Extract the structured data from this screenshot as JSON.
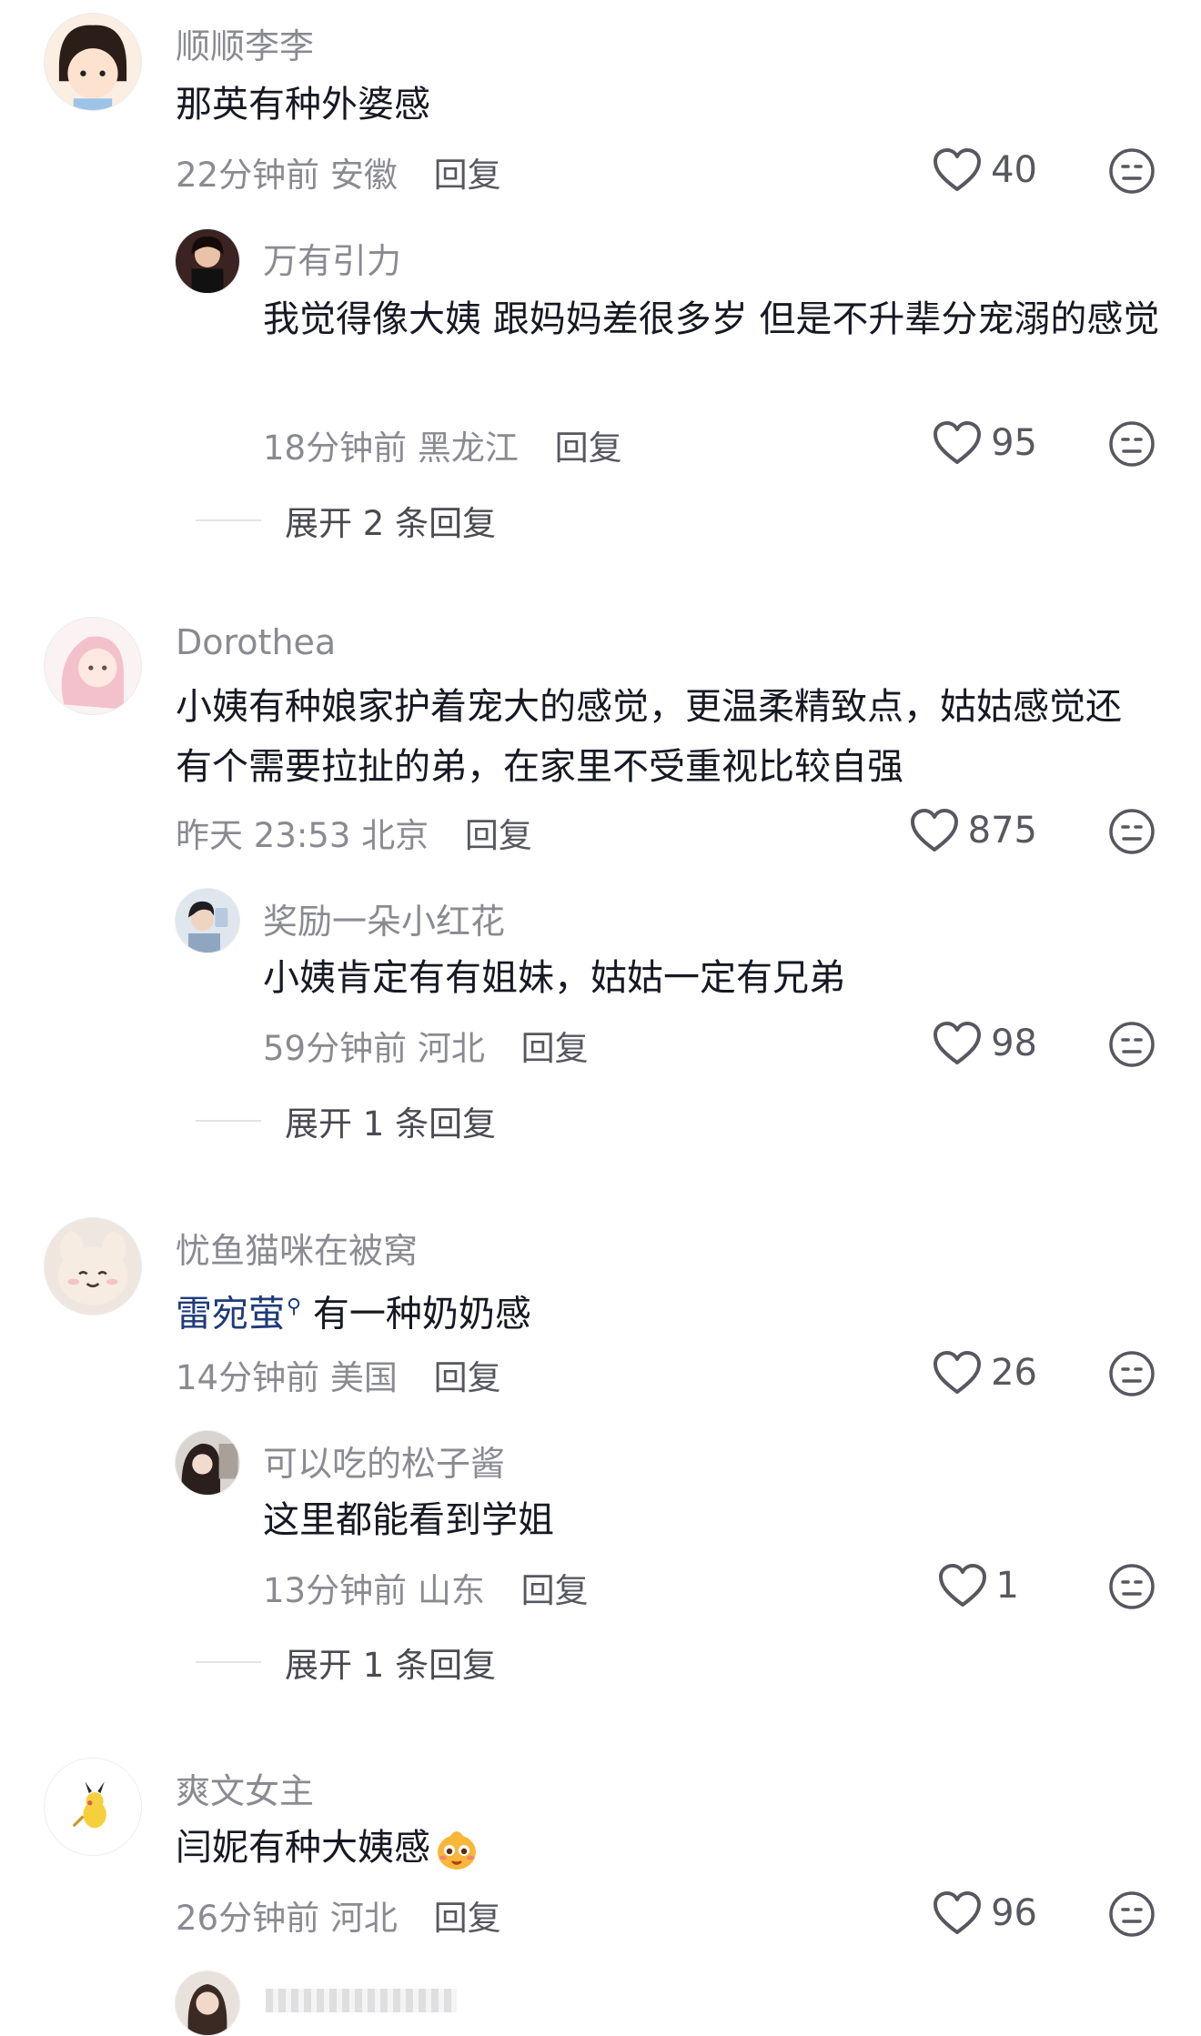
{
  "comments": [
    {
      "user": "顺顺李李",
      "text": "那英有种外婆感",
      "time": "22分钟前",
      "location": "安徽",
      "reply_label": "回复",
      "likes": "40",
      "avatar_icon": "cartoon-girl-avatar",
      "replies": [
        {
          "user": "万有引力",
          "text": "我觉得像大姨 跟妈妈差很多岁 但是不升辈分宠溺的感觉",
          "time": "18分钟前",
          "location": "黑龙江",
          "reply_label": "回复",
          "likes": "95",
          "avatar_icon": "woman-portrait-avatar"
        }
      ],
      "expand_label": "展开 2 条回复"
    },
    {
      "user": "Dorothea",
      "text": "小姨有种娘家护着宠大的感觉，更温柔精致点，姑姑感觉还有个需要拉扯的弟，在家里不受重视比较自强",
      "time": "昨天 23:53",
      "location": "北京",
      "reply_label": "回复",
      "likes": "875",
      "avatar_icon": "anime-girl-avatar",
      "replies": [
        {
          "user": "奖励一朵小红花",
          "text": "小姨肯定有有姐妹，姑姑一定有兄弟",
          "time": "59分钟前",
          "location": "河北",
          "reply_label": "回复",
          "likes": "98",
          "avatar_icon": "photo-avatar"
        }
      ],
      "expand_label": "展开 1 条回复"
    },
    {
      "user": "忧鱼猫咪在被窝",
      "mention": "雷宛萤",
      "text": "有一种奶奶感",
      "time": "14分钟前",
      "location": "美国",
      "reply_label": "回复",
      "likes": "26",
      "avatar_icon": "plush-bunny-avatar",
      "replies": [
        {
          "user": "可以吃的松子酱",
          "text": "这里都能看到学姐",
          "time": "13分钟前",
          "location": "山东",
          "reply_label": "回复",
          "likes": "1",
          "avatar_icon": "selfie-avatar"
        }
      ],
      "expand_label": "展开 1 条回复"
    },
    {
      "user": "爽文女主",
      "text": "闫妮有种大姨感",
      "time": "26分钟前",
      "location": "河北",
      "reply_label": "回复",
      "likes": "96",
      "avatar_icon": "pikachu-avatar",
      "emoji_icon": "cute-face-emoji"
    }
  ],
  "colors": {
    "username": "#8a8b91",
    "text": "#161823",
    "meta": "#8a8b91",
    "mention": "#1f3b7a",
    "icon": "#57585f"
  }
}
